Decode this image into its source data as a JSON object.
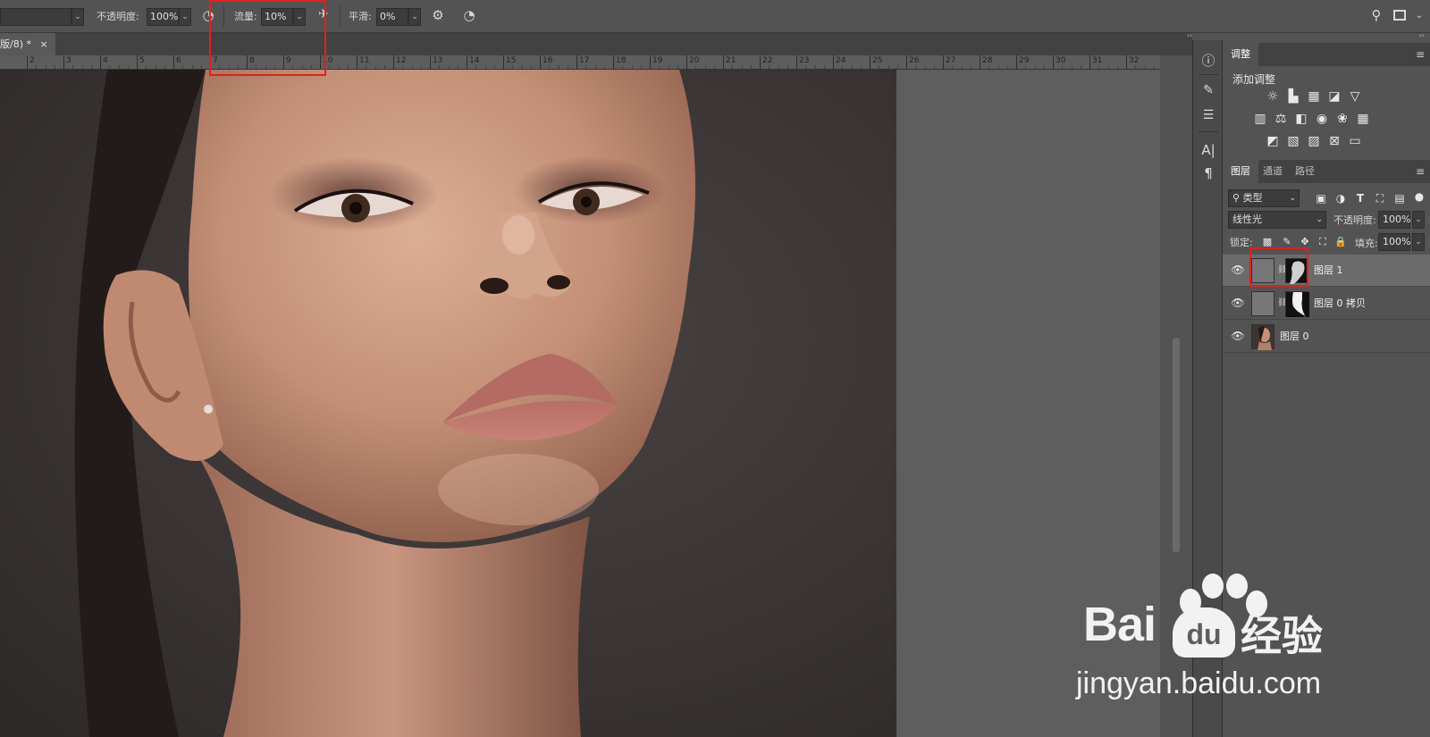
{
  "options_bar": {
    "mode_value": "",
    "opacity_label": "不透明度:",
    "opacity_value": "100%",
    "flow_label": "流量:",
    "flow_value": "10%",
    "smoothing_label": "平滑:",
    "smoothing_value": "0%"
  },
  "document_tab": {
    "title": "版/8) *",
    "close": "×"
  },
  "ruler": {
    "labels": [
      "2",
      "3",
      "4",
      "5",
      "6",
      "7",
      "8",
      "9",
      "10",
      "11",
      "12",
      "13",
      "14",
      "15",
      "16",
      "17",
      "18",
      "19",
      "20",
      "21",
      "22",
      "23",
      "24",
      "25",
      "26",
      "27",
      "28",
      "29",
      "30",
      "31",
      "32"
    ]
  },
  "adjustments_panel": {
    "tab": "调整",
    "heading": "添加调整",
    "icons": [
      "brightness-contrast-icon",
      "levels-icon",
      "curves-icon",
      "exposure-icon",
      "vibrance-icon",
      "hue-saturation-icon",
      "color-balance-icon",
      "black-white-icon",
      "photo-filter-icon",
      "channel-mixer-icon",
      "color-lookup-icon",
      "invert-icon",
      "posterize-icon",
      "threshold-icon",
      "selective-color-icon",
      "gradient-map-icon"
    ]
  },
  "layers_panel": {
    "tabs": [
      "图层",
      "通道",
      "路径"
    ],
    "filter_kind": "类型",
    "blend_mode": "线性光",
    "opacity_label": "不透明度:",
    "opacity_value": "100%",
    "lock_label": "锁定:",
    "fill_label": "填充:",
    "fill_value": "100%",
    "layers": [
      {
        "name": "图层 1",
        "selected": true
      },
      {
        "name": "图层 0 拷贝",
        "selected": false
      },
      {
        "name": "图层 0",
        "selected": false
      }
    ]
  },
  "watermark": {
    "logo_text": "Bai",
    "logo_du": "du",
    "logo_cn": "经验",
    "url": "jingyan.baidu.com"
  },
  "colors": {
    "highlight_box": "#e02020",
    "panel_bg": "#535353",
    "selected_layer": "#6b6b6b"
  }
}
